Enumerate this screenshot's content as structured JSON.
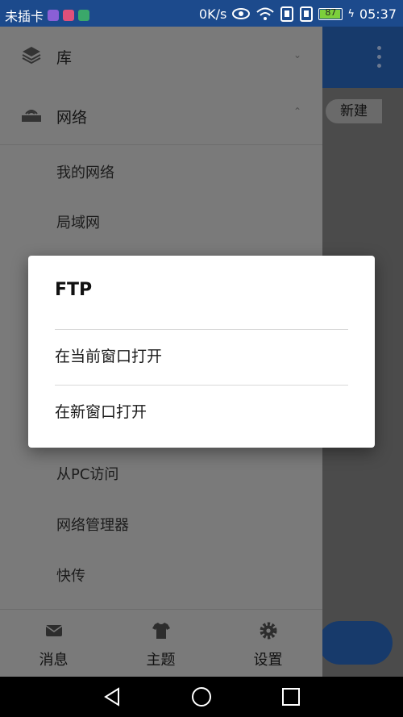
{
  "status_bar": {
    "carrier": "未插卡",
    "speed": "0K/s",
    "battery": "87",
    "time": "05:37"
  },
  "app": {
    "new_label": "新建"
  },
  "drawer": {
    "library_label": "库",
    "network_label": "网络",
    "network_items": [
      "我的网络",
      "局域网"
    ],
    "lower_items": [
      "从PC访问",
      "网络管理器",
      "快传"
    ]
  },
  "bottom_nav": {
    "messages": "消息",
    "theme": "主题",
    "settings": "设置"
  },
  "dialog": {
    "title": "FTP",
    "option_current": "在当前窗口打开",
    "option_new": "在新窗口打开"
  }
}
